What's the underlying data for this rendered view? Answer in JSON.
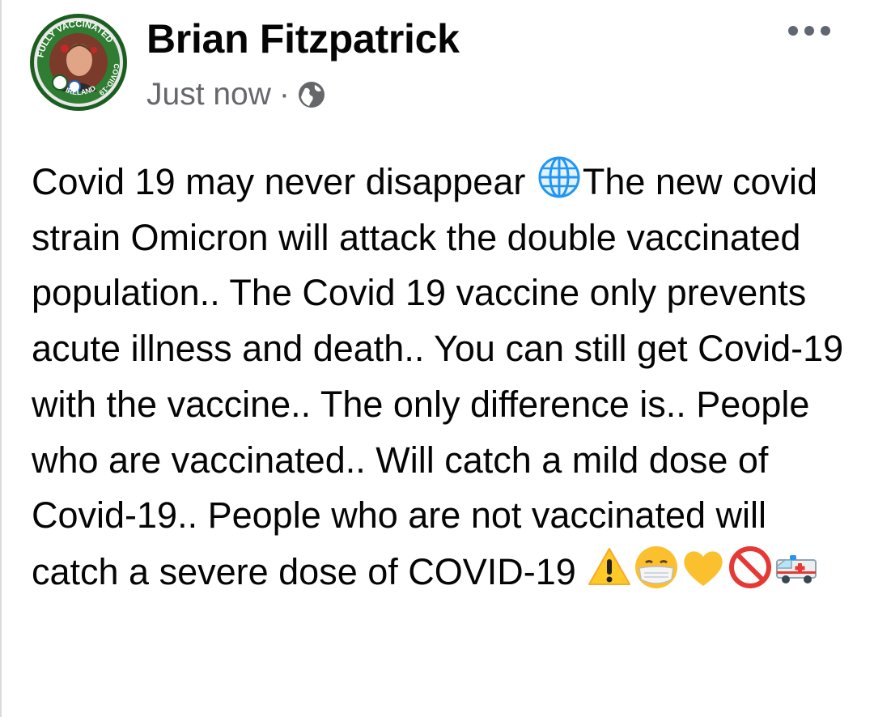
{
  "post": {
    "author_name": "Brian Fitzpatrick",
    "timestamp": "Just now",
    "separator": "·",
    "privacy_icon": "globe-icon",
    "more_icon": "more-options-icon",
    "avatar": {
      "badge_text_top": "FULLY VACCINATED",
      "badge_text_right": "COVID-19",
      "badge_text_bottom": "IRELAND",
      "badge_ring_color": "#2e7d32"
    },
    "text": {
      "part1": "Covid 19 may never disappear ",
      "part2": "The new covid strain Omicron will attack the double vaccinated population.. The Covid 19 vaccine only prevents acute illness and death.. You can still get Covid-19 with the vaccine.. The only difference is.. People who are vaccinated.. Will catch a mild dose of Covid-19.. People who are not vaccinated will catch a severe dose of COVID-19 "
    },
    "emojis": [
      "globe-with-meridians-emoji",
      "warning-emoji",
      "face-with-medical-mask-emoji",
      "yellow-heart-emoji",
      "prohibited-emoji",
      "ambulance-emoji"
    ]
  },
  "colors": {
    "text": "#050505",
    "meta": "#65676b",
    "icon": "#606770"
  }
}
